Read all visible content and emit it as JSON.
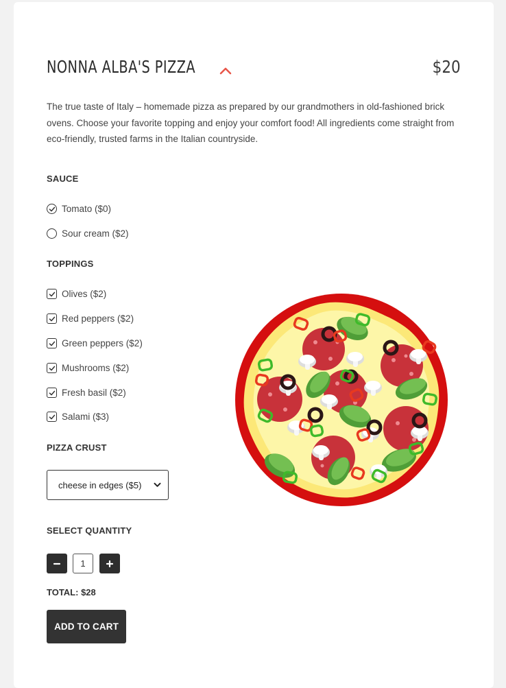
{
  "product": {
    "title": "NONNA ALBA'S PIZZA",
    "price": "$20",
    "description": "The true taste of Italy – homemade pizza as prepared by our grandmothers in old-fashioned brick ovens. Choose your favorite topping and enjoy your comfort food! All ingredients come straight from eco-friendly, trusted farms in the Italian countryside."
  },
  "sauce": {
    "label": "SAUCE",
    "options": [
      {
        "label": "Tomato ($0)",
        "selected": true
      },
      {
        "label": "Sour cream ($2)",
        "selected": false
      }
    ]
  },
  "toppings": {
    "label": "TOPPINGS",
    "options": [
      {
        "label": "Olives ($2)",
        "checked": true
      },
      {
        "label": "Red peppers ($2)",
        "checked": true
      },
      {
        "label": "Green peppers ($2)",
        "checked": true
      },
      {
        "label": "Mushrooms ($2)",
        "checked": true
      },
      {
        "label": "Fresh basil ($2)",
        "checked": true
      },
      {
        "label": "Salami ($3)",
        "checked": true
      }
    ]
  },
  "crust": {
    "label": "PIZZA CRUST",
    "selected": "cheese in edges ($5)"
  },
  "quantity": {
    "label": "SELECT QUANTITY",
    "value": "1",
    "minus": "−",
    "plus": "+"
  },
  "total": "TOTAL: $28",
  "add_to_cart": "ADD TO CART",
  "colors": {
    "accent": "#e8574a",
    "button": "#333333",
    "crust_red": "#d50f0f",
    "cheese": "#fdf6a8",
    "salami": "#c8323a",
    "basil": "#6cb248"
  },
  "icons": {
    "collapse": "chevron-up-icon",
    "select_arrow": "chevron-down-icon"
  }
}
